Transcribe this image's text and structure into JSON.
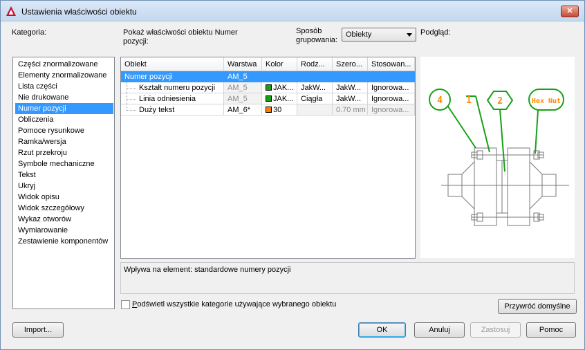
{
  "window": {
    "title": "Ustawienia właściwości obiektu",
    "close_glyph": "✕"
  },
  "labels": {
    "category": "Kategoria:",
    "show_props_line1": "Pokaż właściwości obiektu Numer",
    "show_props_line2": "pozycji:",
    "grouping_line1": "Sposób",
    "grouping_line2": "grupowania:",
    "preview": "Podgląd:"
  },
  "grouping": {
    "selected": "Obiekty"
  },
  "categories": [
    {
      "label": "Części znormalizowane"
    },
    {
      "label": "Elementy znormalizowane"
    },
    {
      "label": "Lista części"
    },
    {
      "label": "Nie drukowane"
    },
    {
      "label": "Numer pozycji",
      "selected": true
    },
    {
      "label": "Obliczenia"
    },
    {
      "label": "Pomoce rysunkowe"
    },
    {
      "label": "Ramka/wersja"
    },
    {
      "label": "Rzut przekroju"
    },
    {
      "label": "Symbole mechaniczne"
    },
    {
      "label": "Tekst"
    },
    {
      "label": "Ukryj"
    },
    {
      "label": "Widok opisu"
    },
    {
      "label": "Widok szczegółowy"
    },
    {
      "label": "Wykaz otworów"
    },
    {
      "label": "Wymiarowanie"
    },
    {
      "label": "Zestawienie komponentów"
    }
  ],
  "grid": {
    "columns": [
      "Obiekt",
      "Warstwa",
      "Kolor",
      "Rodz...",
      "Szero...",
      "Stosowan..."
    ],
    "rows": [
      {
        "obiekt": "Numer pozycji",
        "warstwa": "AM_5",
        "kolor": "",
        "rodzaj": "",
        "szerokosc": "",
        "stosowanie": "",
        "selected": true
      },
      {
        "obiekt": "Kształt numeru pozycji",
        "warstwa": "AM_5",
        "kolor": "JAK...",
        "kolor_color": "#1a9e1a",
        "rodzaj": "JakW...",
        "szerokosc": "JakW...",
        "stosowanie": "Ignorowa..."
      },
      {
        "obiekt": "Linia odniesienia",
        "warstwa": "AM_5",
        "kolor": "JAK...",
        "kolor_color": "#1a9e1a",
        "rodzaj": "Ciągła",
        "szerokosc": "JakW...",
        "stosowanie": "Ignorowa..."
      },
      {
        "obiekt": "Duży tekst",
        "warstwa": "AM_6*",
        "kolor": "30",
        "kolor_color": "#ff7f00",
        "rodzaj": "",
        "szerokosc": "0.70 mm",
        "stosowanie": "Ignorowa..."
      }
    ]
  },
  "preview_drawing": {
    "balloons": [
      "4",
      "1",
      "2",
      "Hex Nut"
    ],
    "accent_green": "#18a018",
    "accent_orange": "#ff8a00"
  },
  "description": "Wpływa na element: standardowe numery pozycji",
  "highlight_checkbox": {
    "label": "Podświetl wszystkie kategorie używające wybranego obiektu",
    "checked": false
  },
  "buttons": {
    "restore_defaults": "Przywróć domyślne",
    "import": "Import...",
    "ok": "OK",
    "cancel": "Anuluj",
    "apply": "Zastosuj",
    "help": "Pomoc"
  }
}
